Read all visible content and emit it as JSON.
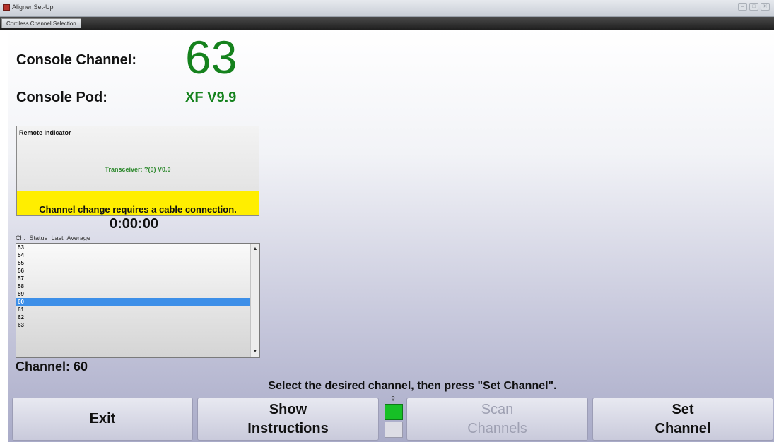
{
  "window": {
    "title": "Aligner Set-Up",
    "controls": [
      "–",
      "□",
      "✕"
    ],
    "tab": "Cordless Channel Selection"
  },
  "console": {
    "channel_label": "Console Channel:",
    "channel_value": "63",
    "pod_label": "Console Pod:",
    "pod_value": "XF V9.9"
  },
  "remote": {
    "title": "Remote Indicator",
    "transceiver": "Transceiver: ?(0) V0.0",
    "warning": "Channel change requires a cable connection."
  },
  "timer": "0:00:00",
  "list": {
    "header": "Ch. Status Last Average",
    "rows": [
      "53",
      "54",
      "55",
      "56",
      "57",
      "58",
      "59",
      "60",
      "61",
      "62",
      "63"
    ],
    "selected": "60"
  },
  "selected_channel": "Channel: 60",
  "instruction": "Select the desired channel, then press \"Set Channel\".",
  "buttons": {
    "exit": "Exit",
    "show_instructions": "Show\nInstructions",
    "scan_channels": "Scan\nChannels",
    "set_channel": "Set\nChannel"
  },
  "colors": {
    "accent_green": "#15821d",
    "warning_yellow": "#ffee00",
    "selection_blue": "#3d8fe8"
  }
}
